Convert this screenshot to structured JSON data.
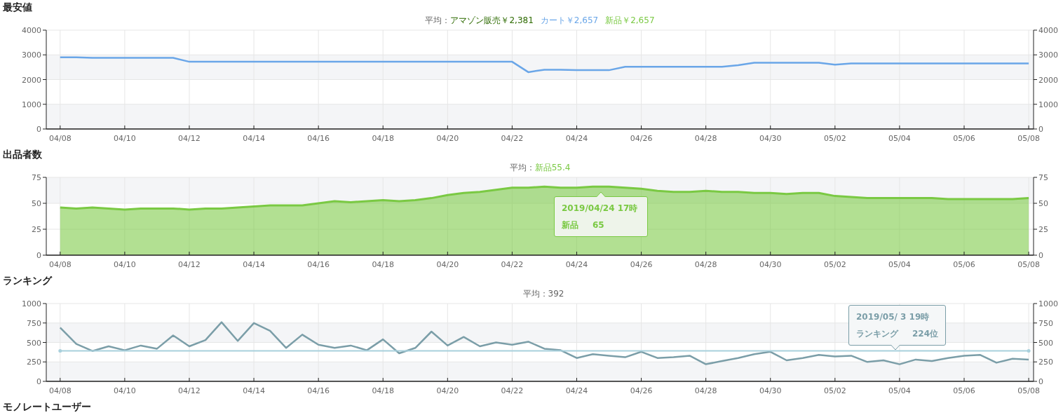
{
  "sections": [
    {
      "title": "最安値",
      "legend": {
        "prefix": "平均：",
        "items": [
          {
            "text": "アマゾン販売￥2,381",
            "color": "#2d6a00"
          },
          {
            "text": "カート￥2,657",
            "color": "#6aa6e8"
          },
          {
            "text": "新品￥2,657",
            "color": "#7ac943"
          }
        ]
      },
      "chart_data": {
        "type": "line",
        "grid": true,
        "ylim": [
          0,
          4000
        ],
        "yticks": [
          0,
          1000,
          2000,
          3000,
          4000
        ],
        "categories": [
          "04/08",
          null,
          null,
          null,
          "04/10",
          null,
          null,
          null,
          "04/12",
          null,
          null,
          null,
          "04/14",
          null,
          null,
          null,
          "04/16",
          null,
          null,
          null,
          "04/18",
          null,
          null,
          null,
          "04/20",
          null,
          null,
          null,
          "04/22",
          null,
          null,
          null,
          "04/24",
          null,
          null,
          null,
          "04/26",
          null,
          null,
          null,
          "04/28",
          null,
          null,
          null,
          "04/30",
          null,
          null,
          null,
          "05/02",
          null,
          null,
          null,
          "05/04",
          null,
          null,
          null,
          "05/06",
          null,
          null,
          null,
          "05/08"
        ],
        "series": [
          {
            "color": "#6aa6e8",
            "values": [
              2900,
              2900,
              2880,
              2880,
              2880,
              2880,
              2880,
              2880,
              2720,
              2720,
              2720,
              2720,
              2720,
              2720,
              2720,
              2720,
              2720,
              2720,
              2720,
              2720,
              2720,
              2720,
              2720,
              2720,
              2720,
              2720,
              2720,
              2720,
              2720,
              2300,
              2400,
              2400,
              2380,
              2380,
              2380,
              2520,
              2520,
              2520,
              2520,
              2520,
              2520,
              2520,
              2580,
              2680,
              2680,
              2680,
              2680,
              2680,
              2600,
              2650,
              2650,
              2650,
              2650,
              2650,
              2650,
              2650,
              2650,
              2650,
              2650,
              2650,
              2650
            ]
          }
        ]
      },
      "left_axis_labels": [
        "4000",
        "3000",
        "2000",
        "1000",
        "0"
      ],
      "right_axis_labels": [
        "4000",
        "3000",
        "2000",
        "1000",
        "0"
      ]
    },
    {
      "title": "出品者数",
      "legend": {
        "prefix": "平均：",
        "items": [
          {
            "text": "新品55.4",
            "color": "#7ac943"
          }
        ]
      },
      "chart_data": {
        "type": "area",
        "grid": true,
        "ylim": [
          0,
          75
        ],
        "yticks": [
          0,
          25,
          50,
          75
        ],
        "categories": [
          "04/08",
          null,
          null,
          null,
          "04/10",
          null,
          null,
          null,
          "04/12",
          null,
          null,
          null,
          "04/14",
          null,
          null,
          null,
          "04/16",
          null,
          null,
          null,
          "04/18",
          null,
          null,
          null,
          "04/20",
          null,
          null,
          null,
          "04/22",
          null,
          null,
          null,
          "04/24",
          null,
          null,
          null,
          "04/26",
          null,
          null,
          null,
          "04/28",
          null,
          null,
          null,
          "04/30",
          null,
          null,
          null,
          "05/02",
          null,
          null,
          null,
          "05/04",
          null,
          null,
          null,
          "05/06",
          null,
          null,
          null,
          "05/08"
        ],
        "series": [
          {
            "color": "#7ac943",
            "values": [
              46,
              45,
              46,
              45,
              44,
              45,
              45,
              45,
              44,
              45,
              45,
              46,
              47,
              48,
              48,
              48,
              50,
              52,
              51,
              52,
              53,
              52,
              53,
              55,
              58,
              60,
              61,
              63,
              65,
              65,
              66,
              65,
              65,
              66,
              66,
              65,
              64,
              62,
              61,
              61,
              62,
              61,
              61,
              60,
              60,
              59,
              60,
              60,
              57,
              56,
              55,
              55,
              55,
              55,
              55,
              54,
              54,
              54,
              54,
              54,
              55
            ]
          }
        ]
      },
      "left_axis_labels": [
        "75",
        "50",
        "25",
        "0"
      ],
      "right_axis_labels": [
        "75",
        "50",
        "25",
        "0"
      ],
      "tooltip": {
        "title": "2019/04/24 17時",
        "label": "新品",
        "value": "65"
      }
    },
    {
      "title": "ランキング",
      "legend": {
        "prefix": "平均：392"
      },
      "chart_data": {
        "type": "line",
        "ylim": [
          0,
          1000
        ],
        "yticks": [
          0,
          250,
          500,
          750,
          1000
        ],
        "categories": [
          "04/08",
          null,
          null,
          null,
          "04/10",
          null,
          null,
          null,
          "04/12",
          null,
          null,
          null,
          "04/14",
          null,
          null,
          null,
          "04/16",
          null,
          null,
          null,
          "04/18",
          null,
          null,
          null,
          "04/20",
          null,
          null,
          null,
          "04/22",
          null,
          null,
          null,
          "04/24",
          null,
          null,
          null,
          "04/26",
          null,
          null,
          null,
          "04/28",
          null,
          null,
          null,
          "04/30",
          null,
          null,
          null,
          "05/02",
          null,
          null,
          null,
          "05/04",
          null,
          null,
          null,
          "05/06",
          null,
          null,
          null,
          "05/08"
        ],
        "series": [
          {
            "color": "#7b9ea8",
            "values": [
              690,
              480,
              390,
              450,
              400,
              460,
              420,
              590,
              450,
              530,
              760,
              520,
              750,
              650,
              430,
              600,
              470,
              430,
              460,
              400,
              540,
              360,
              430,
              640,
              460,
              570,
              450,
              500,
              470,
              510,
              420,
              400,
              300,
              350,
              330,
              310,
              380,
              300,
              310,
              330,
              220,
              260,
              300,
              350,
              380,
              270,
              300,
              340,
              320,
              330,
              250,
              270,
              220,
              280,
              260,
              300,
              330,
              340,
              240,
              290,
              280
            ]
          },
          {
            "color": "#a8d0dc",
            "values": [
              392,
              392,
              392,
              392,
              392,
              392,
              392,
              392,
              392,
              392,
              392,
              392,
              392,
              392,
              392,
              392,
              392,
              392,
              392,
              392,
              392,
              392,
              392,
              392,
              392,
              392,
              392,
              392,
              392,
              392,
              392,
              392,
              392,
              392,
              392,
              392,
              392,
              392,
              392,
              392,
              392,
              392,
              392,
              392,
              392,
              392,
              392,
              392,
              392,
              392,
              392,
              392,
              392,
              392,
              392,
              392,
              392,
              392,
              392,
              392,
              392
            ]
          }
        ],
        "grid": true
      },
      "left_axis_labels": [
        "1000",
        "750",
        "500",
        "250",
        "0"
      ],
      "right_axis_labels": [
        "1000",
        "750",
        "500",
        "250",
        "0"
      ],
      "tooltip": {
        "title": "2019/05/ 3 19時",
        "label": "ランキング",
        "value": "224位"
      }
    },
    {
      "title": "モノレートユーザー"
    }
  ]
}
